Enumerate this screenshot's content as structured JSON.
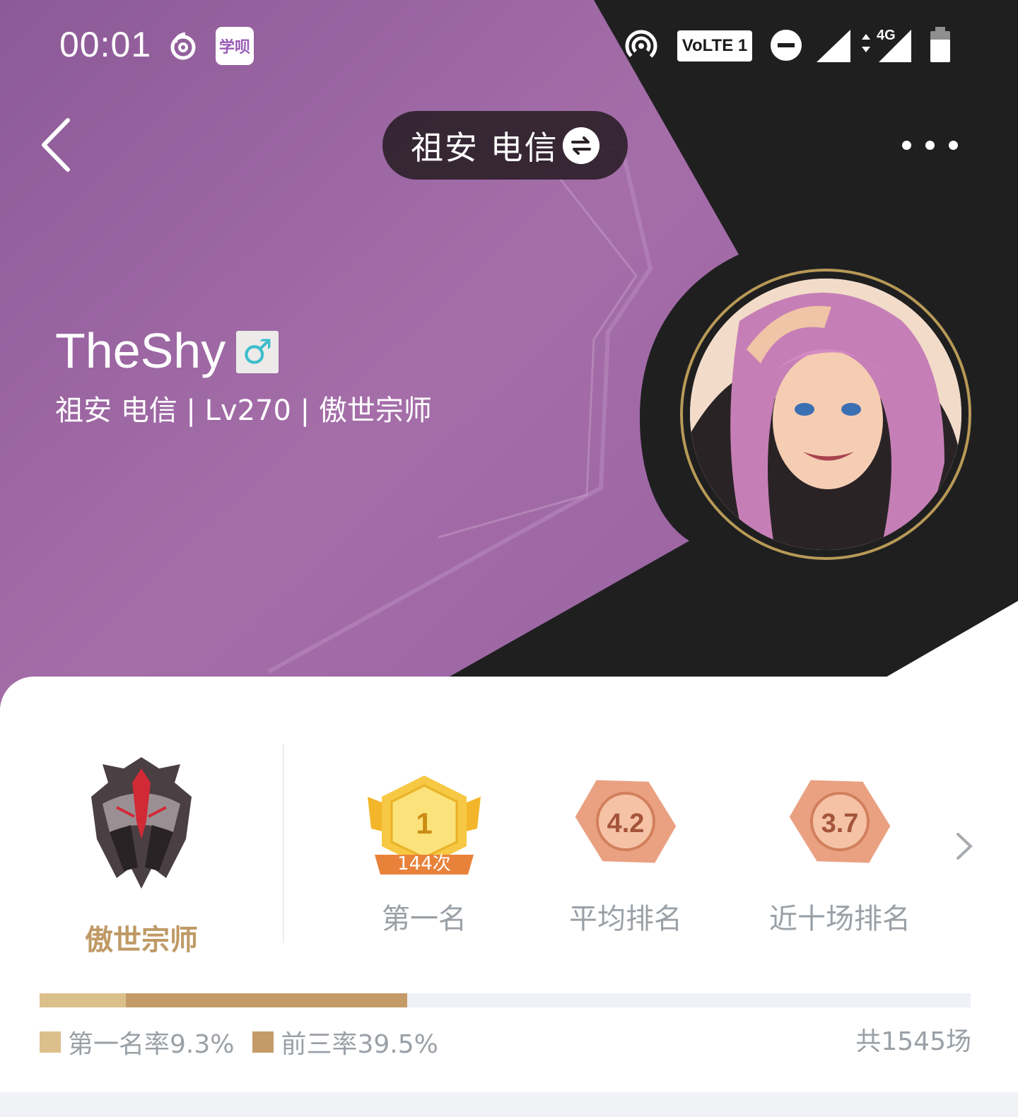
{
  "status_bar": {
    "time": "00:01",
    "app_badge": "学呗",
    "volte": "VoLTE 1",
    "network": "4G",
    "icons": [
      "netease-music-icon",
      "xuebei-app-icon",
      "hotspot-icon",
      "volte-icon",
      "dnd-icon",
      "signal-icon",
      "4g-signal-icon",
      "battery-icon"
    ]
  },
  "header": {
    "back_icon": "chevron-left-icon",
    "server_label": "祖安 电信",
    "swap_icon": "swap-arrows-icon",
    "more_icon": "more-dots-icon"
  },
  "profile": {
    "username": "TheShy",
    "gender_symbol": "♂",
    "gender_icon": "male-icon",
    "subinfo": "祖安 电信 | Lv270 | 傲世宗师"
  },
  "rank": {
    "tier_name": "傲世宗师",
    "tier_icon": "grandmaster-helmet-icon"
  },
  "stats": [
    {
      "badge_value": "1",
      "badge_sub": "144次",
      "caption": "第一名",
      "style": "gold"
    },
    {
      "badge_value": "4.2",
      "caption": "平均排名",
      "style": "bronze"
    },
    {
      "badge_value": "3.7",
      "caption": "近十场排名",
      "style": "bronze"
    }
  ],
  "rates": {
    "first_label": "第一名率9.3%",
    "first_rate": 0.093,
    "top3_label": "前三率39.5%",
    "top3_rate": 0.395,
    "total_label": "共1545场",
    "colors": {
      "first": "#dcc08c",
      "top3": "#c49b67",
      "track": "#eef1f5"
    }
  },
  "colors": {
    "purple": "#9b64a3",
    "dark": "#1f1f20",
    "accent_gold": "#bf9a66"
  }
}
